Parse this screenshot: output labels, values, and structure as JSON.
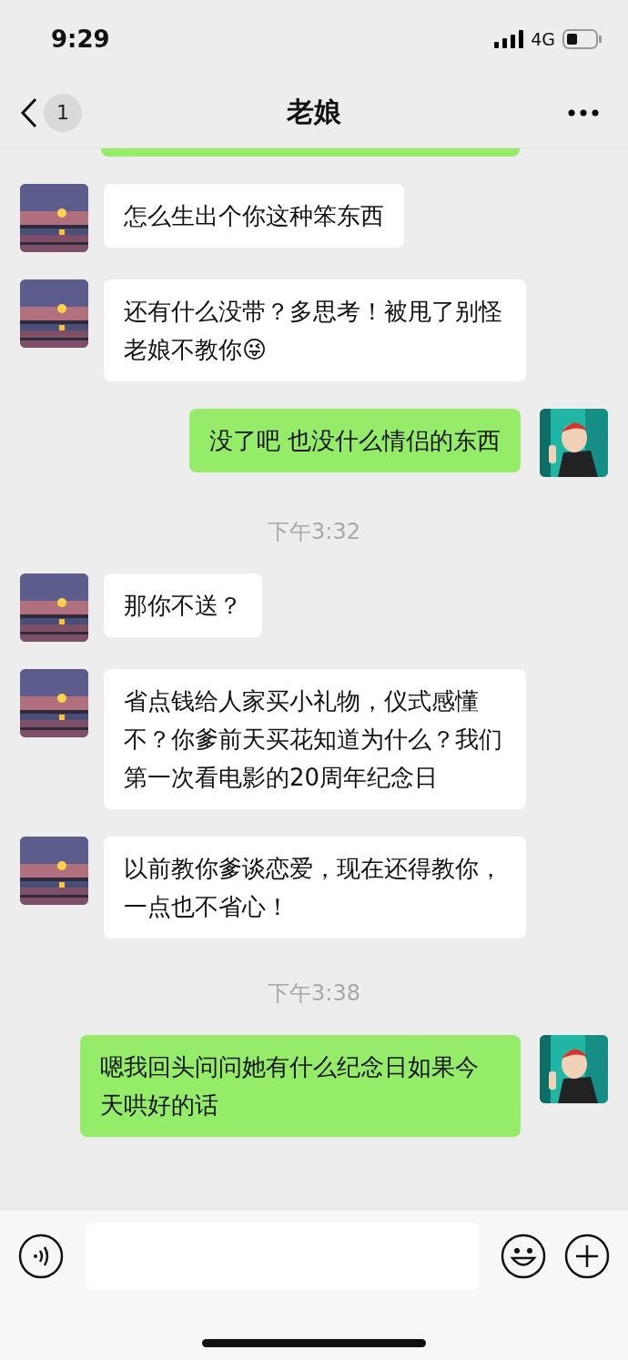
{
  "status_bar": {
    "time": "9:29",
    "network": "4G"
  },
  "header": {
    "back_badge": "1",
    "title": "老娘"
  },
  "messages": [
    {
      "kind": "partial"
    },
    {
      "kind": "incoming",
      "text": "怎么生出个你这种笨东西"
    },
    {
      "kind": "incoming",
      "text": "还有什么没带？多思考！被甩了别怪老娘不教你😜"
    },
    {
      "kind": "outgoing",
      "text": "没了吧 也没什么情侣的东西"
    },
    {
      "kind": "time",
      "text": "下午3:32"
    },
    {
      "kind": "incoming",
      "text": "那你不送？"
    },
    {
      "kind": "incoming",
      "text": "省点钱给人家买小礼物，仪式感懂不？你爹前天买花知道为什么？我们第一次看电影的20周年纪念日"
    },
    {
      "kind": "incoming",
      "text": "以前教你爹谈恋爱，现在还得教你，一点也不省心！"
    },
    {
      "kind": "time",
      "text": "下午3:38"
    },
    {
      "kind": "outgoing",
      "text": "嗯我回头问问她有什么纪念日如果今天哄好的话"
    }
  ]
}
